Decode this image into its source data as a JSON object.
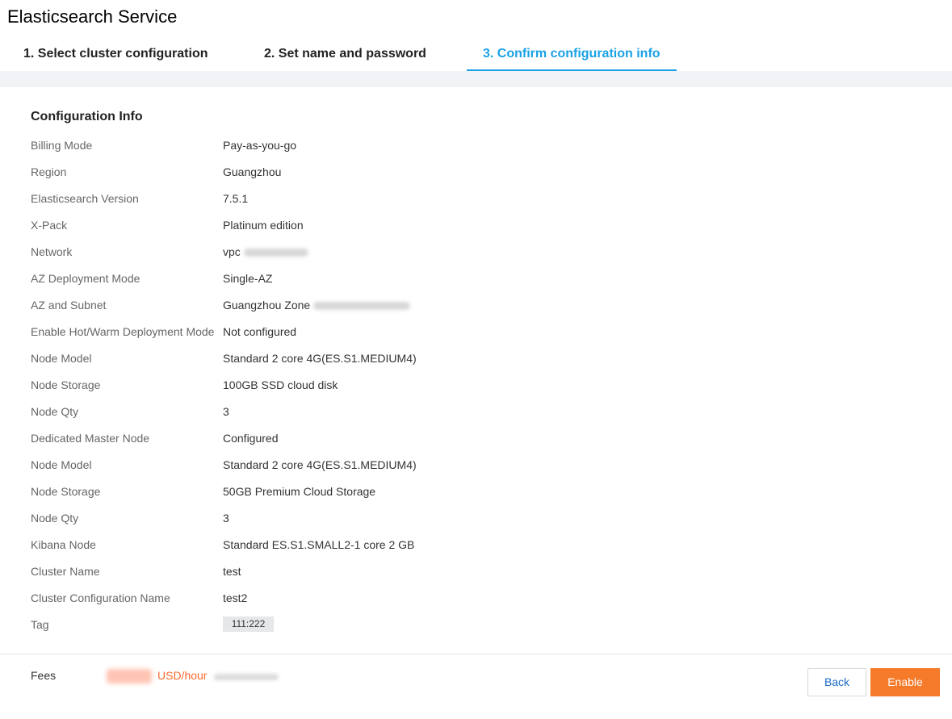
{
  "header": {
    "title": "Elasticsearch Service"
  },
  "steps": [
    {
      "label": "1. Select cluster configuration",
      "active": false
    },
    {
      "label": "2. Set name and password",
      "active": false
    },
    {
      "label": "3. Confirm configuration info",
      "active": true
    }
  ],
  "config": {
    "section_title": "Configuration Info",
    "rows": [
      {
        "label": "Billing Mode",
        "value": "Pay-as-you-go"
      },
      {
        "label": "Region",
        "value": "Guangzhou"
      },
      {
        "label": "Elasticsearch Version",
        "value": "7.5.1"
      },
      {
        "label": "X-Pack",
        "value": "Platinum edition"
      },
      {
        "label": "Network",
        "value": "vpc"
      },
      {
        "label": "AZ Deployment Mode",
        "value": "Single-AZ"
      },
      {
        "label": "AZ and Subnet",
        "value": "Guangzhou Zone"
      },
      {
        "label": "Enable Hot/Warm Deployment Mode",
        "value": "Not configured"
      },
      {
        "label": "Node Model",
        "value": "Standard 2 core 4G(ES.S1.MEDIUM4)"
      },
      {
        "label": "Node Storage",
        "value": "100GB SSD cloud disk"
      },
      {
        "label": "Node Qty",
        "value": "3"
      },
      {
        "label": "Dedicated Master Node",
        "value": "Configured"
      },
      {
        "label": "Node Model",
        "value": "Standard 2 core 4G(ES.S1.MEDIUM4)"
      },
      {
        "label": "Node Storage",
        "value": "50GB Premium Cloud Storage"
      },
      {
        "label": "Node Qty",
        "value": "3"
      },
      {
        "label": "Kibana Node",
        "value": "Standard ES.S1.SMALL2-1 core 2 GB"
      },
      {
        "label": "Cluster Name",
        "value": "test"
      },
      {
        "label": "Cluster Configuration Name",
        "value": "test2"
      }
    ],
    "tag_label": "Tag",
    "tag_value": "111:222"
  },
  "footer": {
    "fees_label": "Fees",
    "fee_unit": "USD/hour",
    "back_label": "Back",
    "enable_label": "Enable"
  },
  "colors": {
    "accent_blue": "#1aa2e6",
    "primary_orange": "#f57a2a",
    "fee_orange": "#ff6a2b"
  }
}
